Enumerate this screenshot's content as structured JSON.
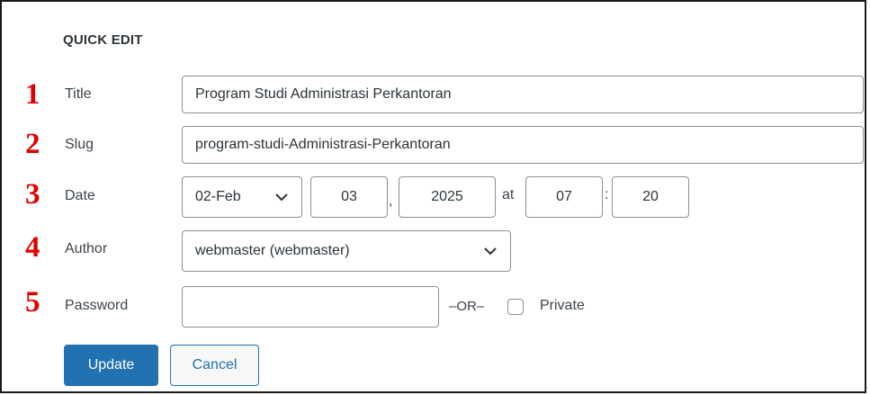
{
  "heading": "QUICK EDIT",
  "markers": [
    "1",
    "2",
    "3",
    "4",
    "5"
  ],
  "labels": {
    "title": "Title",
    "slug": "Slug",
    "date": "Date",
    "author": "Author",
    "password": "Password"
  },
  "fields": {
    "title_value": "Program Studi Administrasi Perkantoran",
    "slug_value": "program-studi-Administrasi-Perkantoran",
    "password_value": ""
  },
  "date": {
    "month_selected": "02-Feb",
    "day": "03",
    "day_separator": ",",
    "year": "2025",
    "at_label": "at",
    "hour": "07",
    "time_separator": ":",
    "minute": "20"
  },
  "author_selected": "webmaster (webmaster)",
  "or_label": "–OR–",
  "private_label": "Private",
  "private_checked": false,
  "buttons": {
    "update": "Update",
    "cancel": "Cancel"
  },
  "colors": {
    "primary": "#2271b1",
    "marker": "#e00000"
  },
  "icons": {
    "select_arrow": "chevron-down-icon"
  }
}
